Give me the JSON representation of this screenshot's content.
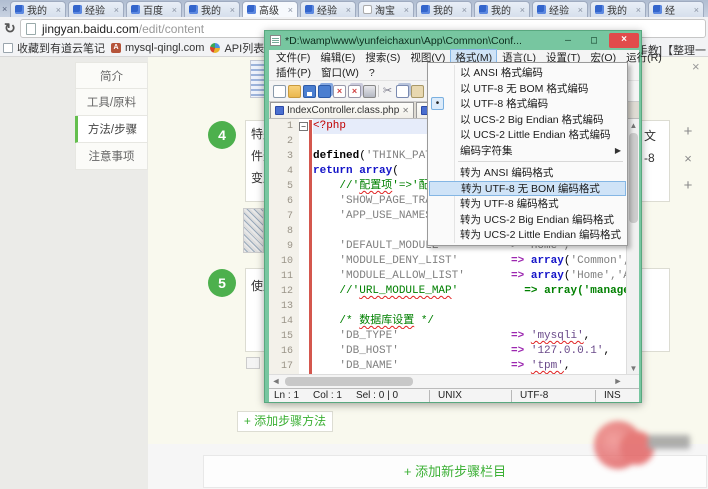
{
  "browser": {
    "edge_close": "×",
    "tabs": [
      {
        "label": "我的",
        "icon": "paw"
      },
      {
        "label": "经验",
        "icon": "paw"
      },
      {
        "label": "百度",
        "icon": "paw"
      },
      {
        "label": "我的",
        "icon": "paw"
      },
      {
        "label": "高级",
        "icon": "paw",
        "active": true
      },
      {
        "label": "经验",
        "icon": "paw"
      },
      {
        "label": "淘宝",
        "icon": "doc"
      },
      {
        "label": "我的",
        "icon": "paw"
      },
      {
        "label": "我的",
        "icon": "paw"
      },
      {
        "label": "经验",
        "icon": "paw"
      },
      {
        "label": "我的",
        "icon": "paw"
      },
      {
        "label": "经",
        "icon": "paw"
      }
    ],
    "url_host": "jingyan.baidu.com",
    "url_path": "/edit/content",
    "bookmarks": [
      {
        "label": "收藏到有道云笔记",
        "icon": "note"
      },
      {
        "label": "mysql-qingl.com",
        "icon": "pma"
      },
      {
        "label": "API列表 - 腾讯开",
        "icon": "api"
      }
    ],
    "bookmark_right": "把手教]【整理一"
  },
  "sidebar": {
    "items": [
      {
        "label": "简介"
      },
      {
        "label": "工具/原料"
      },
      {
        "label": "方法/步骤",
        "active": true
      },
      {
        "label": "注意事项"
      }
    ]
  },
  "content": {
    "step4_num": "4",
    "step4_lines": [
      "特别",
      "件选",
      "变成"
    ],
    "step4_right": [
      "文",
      "-8"
    ],
    "step5_num": "5",
    "step5_line": "使用",
    "add_step_btn": "+ 添加步骤方法",
    "add_section_btn": "+ 添加新步骤栏目",
    "close_x": "×"
  },
  "npp": {
    "title": "*D:\\wamp\\www\\yunfeichaxun\\App\\Common\\Conf...",
    "min": "–",
    "max": "□",
    "close": "×",
    "menu_row1": [
      "文件(F)",
      "编辑(E)",
      "搜索(S)",
      "视图(V)",
      "格式(M)",
      "语言(L)",
      "设置(T)",
      "宏(O)",
      "运行(R)"
    ],
    "menu_active_index": 4,
    "menu_row2": [
      "插件(P)",
      "窗口(W)",
      "?"
    ],
    "toolbar_icons": [
      {
        "k": "new",
        "n": "new-file-icon"
      },
      {
        "k": "open",
        "n": "open-folder-icon"
      },
      {
        "k": "save",
        "n": "save-icon"
      },
      {
        "k": "saveall",
        "n": "save-all-icon"
      },
      {
        "k": "closef",
        "n": "close-file-icon"
      },
      {
        "k": "closeall",
        "n": "close-all-icon"
      },
      {
        "k": "print",
        "n": "print-icon"
      },
      {
        "k": "sep",
        "n": "toolbar-separator"
      },
      {
        "k": "cut",
        "n": "cut-icon"
      },
      {
        "k": "copy",
        "n": "copy-icon"
      },
      {
        "k": "paste",
        "n": "paste-icon"
      }
    ],
    "tab1": "IndexController.class.php",
    "status": {
      "ln": "Ln : 1",
      "col": "Col : 1",
      "sel": "Sel : 0 | 0",
      "eol": "UNIX",
      "enc": "UTF-8",
      "mode": "INS"
    },
    "dropdown": [
      {
        "label": "以 ANSI 格式编码"
      },
      {
        "label": "以 UTF-8 无 BOM 格式编码"
      },
      {
        "label": "以 UTF-8 格式编码",
        "radio": true
      },
      {
        "label": "以 UCS-2 Big Endian 格式编码"
      },
      {
        "label": "以 UCS-2 Little Endian 格式编码"
      },
      {
        "label": "编码字符集",
        "submenu": true
      },
      {
        "sep": true
      },
      {
        "label": "转为 ANSI 编码格式"
      },
      {
        "label": "转为 UTF-8 无 BOM 编码格式",
        "highlight": true
      },
      {
        "label": "转为 UTF-8 编码格式"
      },
      {
        "label": "转为 UCS-2 Big Endian 编码格式"
      },
      {
        "label": "转为 UCS-2 Little Endian 编码格式"
      }
    ],
    "code": [
      [
        {
          "t": "<?php",
          "c": "tag"
        }
      ],
      [],
      [
        {
          "t": "defined",
          "c": "fn"
        },
        {
          "t": "(",
          "c": "pl"
        },
        {
          "t": "'THINK_PATH') or exit();",
          "c": "str"
        }
      ],
      [
        {
          "t": "return array",
          "c": "kw"
        },
        {
          "t": "(",
          "c": "pl"
        }
      ],
      [
        {
          "t": "    //'",
          "c": "cm"
        },
        {
          "t": "配置项",
          "c": "cm sq"
        },
        {
          "t": "'=>'配置值'",
          "c": "cm"
        }
      ],
      [
        {
          "t": "    'SHOW_PAGE_TRACE'        => true,",
          "c": "str"
        }
      ],
      [
        {
          "t": "    'APP_USE_NAMESPACE'      => true,",
          "c": "str"
        }
      ],
      [],
      [
        {
          "t": "    'DEFAULT_MODULE'         => 'Home',",
          "c": "str"
        }
      ],
      [
        {
          "t": "    'MODULE_DENY_LIST'",
          "c": "str"
        },
        {
          "t": "        ",
          "c": "pl"
        },
        {
          "t": "=>",
          "c": "op"
        },
        {
          "t": " ",
          "c": "pl"
        },
        {
          "t": "array",
          "c": "kw"
        },
        {
          "t": "(",
          "c": "pl"
        },
        {
          "t": "'Common',",
          "c": "str"
        }
      ],
      [
        {
          "t": "    'MODULE_ALLOW_LIST'",
          "c": "str"
        },
        {
          "t": "       ",
          "c": "pl"
        },
        {
          "t": "=>",
          "c": "op"
        },
        {
          "t": " ",
          "c": "pl"
        },
        {
          "t": "array",
          "c": "kw"
        },
        {
          "t": "(",
          "c": "pl"
        },
        {
          "t": "'Home','Admin'),",
          "c": "str"
        }
      ],
      [
        {
          "t": "    //'",
          "c": "cm"
        },
        {
          "t": "URL_MODULE_MAP",
          "c": "cm sq"
        },
        {
          "t": "'          ",
          "c": "cm"
        },
        {
          "t": "=> array('manage",
          "c": "cmb"
        }
      ],
      [],
      [
        {
          "t": "    /* ",
          "c": "cm"
        },
        {
          "t": "数据库设置",
          "c": "cm sq"
        },
        {
          "t": " */",
          "c": "cm"
        }
      ],
      [
        {
          "t": "    'DB_TYPE'",
          "c": "str"
        },
        {
          "t": "                 ",
          "c": "pl"
        },
        {
          "t": "=>",
          "c": "op"
        },
        {
          "t": " ",
          "c": "pl"
        },
        {
          "t": "'mysqli'",
          "c": "val sq"
        },
        {
          "t": ",        ",
          "c": "pl"
        },
        {
          "t": "/",
          "c": "cm"
        }
      ],
      [
        {
          "t": "    'DB_HOST'",
          "c": "str"
        },
        {
          "t": "                 ",
          "c": "pl"
        },
        {
          "t": "=>",
          "c": "op"
        },
        {
          "t": " ",
          "c": "pl"
        },
        {
          "t": "'127.0.0.1'",
          "c": "val"
        },
        {
          "t": ",     ",
          "c": "pl"
        },
        {
          "t": "/",
          "c": "cm"
        }
      ],
      [
        {
          "t": "    'DB_NAME'",
          "c": "str"
        },
        {
          "t": "                 ",
          "c": "pl"
        },
        {
          "t": "=>",
          "c": "op"
        },
        {
          "t": " ",
          "c": "pl"
        },
        {
          "t": "'tpm'",
          "c": "val sq"
        },
        {
          "t": ",           ",
          "c": "pl"
        },
        {
          "t": "/",
          "c": "cm"
        }
      ]
    ]
  }
}
